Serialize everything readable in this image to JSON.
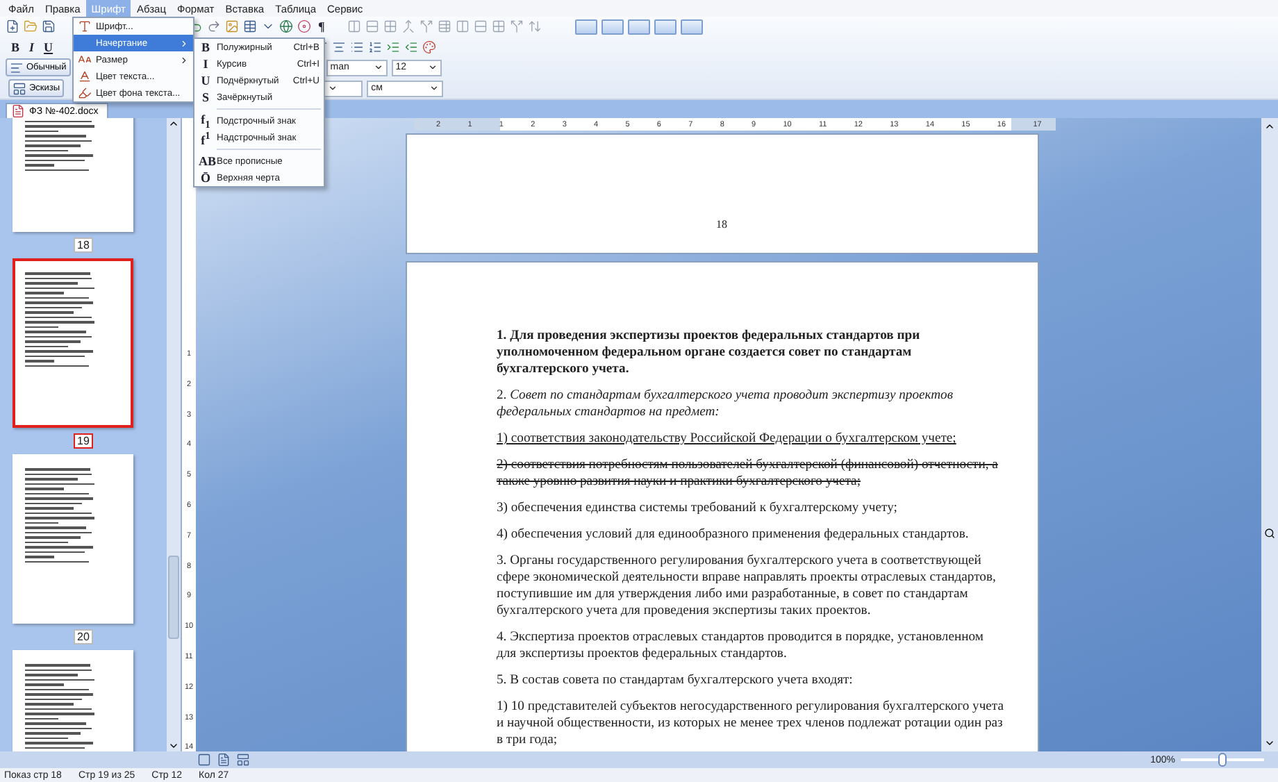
{
  "menu_bar": [
    {
      "label": "Файл",
      "selected": false
    },
    {
      "label": "Правка",
      "selected": false
    },
    {
      "label": "Шрифт",
      "selected": true
    },
    {
      "label": "Абзац",
      "selected": false
    },
    {
      "label": "Формат",
      "selected": false
    },
    {
      "label": "Вставка",
      "selected": false
    },
    {
      "label": "Таблица",
      "selected": false
    },
    {
      "label": "Сервис",
      "selected": false
    }
  ],
  "font_menu": [
    {
      "kind": "font",
      "label": "Шрифт...",
      "submenu": false,
      "selected": false
    },
    {
      "kind": "style",
      "label": "Начертание",
      "submenu": true,
      "selected": true
    },
    {
      "kind": "size",
      "label": "Размер",
      "submenu": true,
      "selected": false
    },
    {
      "kind": "color",
      "label": "Цвет текста...",
      "submenu": false,
      "selected": false
    },
    {
      "kind": "highlight",
      "label": "Цвет фона текста...",
      "submenu": false,
      "selected": false
    }
  ],
  "style_submenu": [
    {
      "glyph": "B",
      "label": "Полужирный",
      "shortcut": "Ctrl+B",
      "separator_before": false
    },
    {
      "glyph": "I",
      "label": "Курсив",
      "shortcut": "Ctrl+I",
      "separator_before": false
    },
    {
      "glyph": "U",
      "label": "Подчёркнутый",
      "shortcut": "Ctrl+U",
      "separator_before": false
    },
    {
      "glyph": "S",
      "label": "Зачёркнутый",
      "separator_before": false
    },
    {
      "glyph": "f$_{1}$",
      "label": "Подстрочный знак",
      "separator_before": true
    },
    {
      "glyph": "f$^{1}$",
      "label": "Надстрочный знак",
      "separator_before": false
    },
    {
      "glyph": "AB",
      "label": "Все прописные",
      "separator_before": true
    },
    {
      "glyph": "Ō",
      "label": "Верхняя черта",
      "separator_before": false
    }
  ],
  "toolbar": {
    "pilcrow": "¶",
    "format_buttons": [
      "B",
      "I",
      "U"
    ],
    "style": "Обычный",
    "font": "man",
    "size": "12",
    "unit": "см",
    "thumbnails_button": "Эскизы"
  },
  "document_tab": "ФЗ №-402.docx",
  "thumbnails": [
    {
      "label": "18",
      "selected": false
    },
    {
      "label": "19",
      "selected": true
    },
    {
      "label": "20",
      "selected": false
    },
    {
      "selected": false
    }
  ],
  "horizontal_ruler": [
    "2",
    "1",
    "1",
    "2",
    "3",
    "4",
    "5",
    "6",
    "7",
    "8",
    "9",
    "10",
    "11",
    "12",
    "13",
    "14",
    "15",
    "16",
    "17"
  ],
  "vertical_ruler": [
    "1",
    "2",
    "3",
    "4",
    "5",
    "6",
    "7",
    "8",
    "9",
    "10",
    "11",
    "12",
    "13",
    "14"
  ],
  "previous_page_number": "18",
  "paragraphs": [
    {
      "kind": "bold",
      "text": "1. Для проведения экспертизы проектов федеральных стандартов при уполномоченном федеральном органе создается совет по стандартам бухгалтерского учета."
    },
    {
      "kind": "plain",
      "text": "2. *Совет по стандартам бухгалтерского учета проводит экспертизу проектов федеральных стандартов на предмет:*"
    },
    {
      "kind": "underline",
      "text": "1) соответствия законодательству Российской Федерации о бухгалтерском учете;"
    },
    {
      "kind": "strike",
      "text": "2) соответствия потребностям пользователей бухгалтерской (финансовой) отчетности, а также уровню развития науки и практики бухгалтерского учета;"
    },
    {
      "kind": "plain",
      "text": "3) обеспечения единства системы требований к бухгалтерскому учету;"
    },
    {
      "kind": "plain",
      "text": "4) обеспечения условий для единообразного применения федеральных стандартов."
    },
    {
      "kind": "plain",
      "text": "3. Органы государственного регулирования бухгалтерского учета в соответствующей сфере экономической деятельности вправе направлять проекты отраслевых стандартов, поступившие им для утверждения либо ими разработанные, в совет по стандартам бухгалтерского учета для проведения экспертизы таких проектов."
    },
    {
      "kind": "plain",
      "text": "4. Экспертиза проектов отраслевых стандартов проводится в порядке, установленном для экспертизы проектов федеральных стандартов."
    },
    {
      "kind": "plain",
      "text": "5. В состав совета по стандартам бухгалтерского учета входят:"
    },
    {
      "kind": "plain",
      "text": "1) 10 представителей субъектов негосударственного регулирования бухгалтерского учета и научной общественности, из которых не менее трех членов подлежат ротации один раз в три года;"
    }
  ],
  "zoom": {
    "label": "100%",
    "level": 0.5
  },
  "status_bar": [
    "Показ стр 18",
    "Стр 19 из 25",
    "Стр 12",
    "Кол 27"
  ]
}
